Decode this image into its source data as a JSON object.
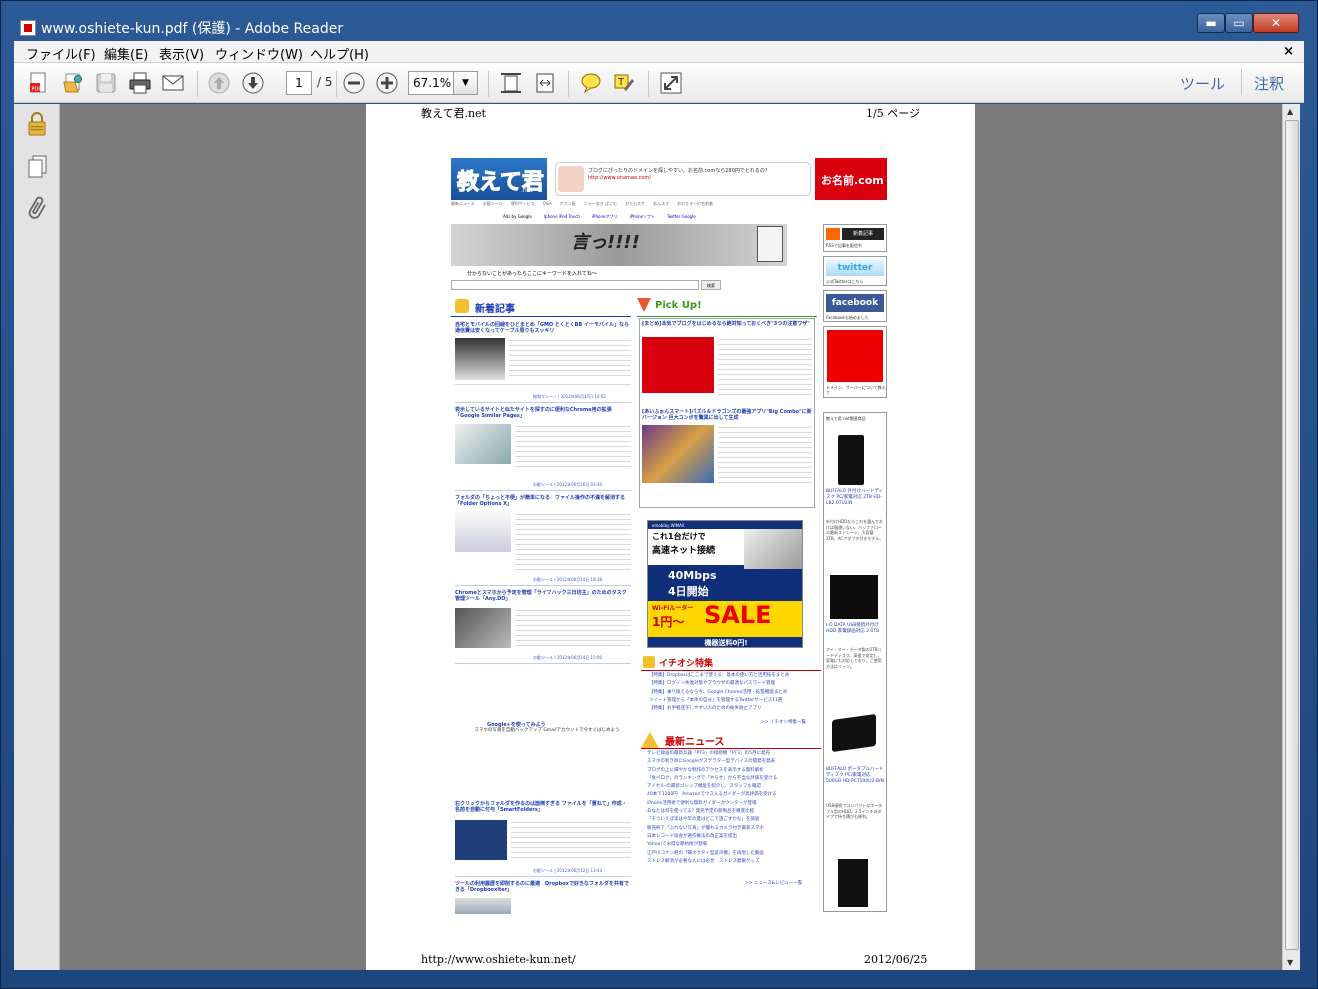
{
  "window": {
    "title": "www.oshiete-kun.pdf (保護) - Adobe Reader",
    "min": "▬",
    "max": "▭",
    "close": "✕"
  },
  "menus": [
    "ファイル(F)",
    "編集(E)",
    "表示(V)",
    "ウィンドウ(W)",
    "ヘルプ(H)"
  ],
  "menu_close": "×",
  "toolbar": {
    "page_current": "1",
    "page_total": "/ 5",
    "zoom": "67.1%",
    "tools": "ツール",
    "comment": "注釈"
  },
  "document": {
    "header_left": "教えて君.net",
    "header_right": "1/5 ページ",
    "footer_left": "http://www.oshiete-kun.net/",
    "footer_right": "2012/06/25",
    "logo": "教えて君",
    "logo_net": ".net",
    "ad_text": "ブログにぴったりのドメインを探しやすい。お名前.comなら280円でとれるの?",
    "ad_url": "http://www.onamae.com/",
    "ad_brand": "お名前.com",
    "nav": "最新ニュース　　お勧ツール　　便利サービス　　Q&A　　ボカン板　　ニャーおき ぱこむ　　おたもスケ　　あんスマ　　おわりマーの名前着",
    "adlinks": [
      "Ads by Google",
      "Iphone iPod Touch",
      "iPhoneアプリ",
      "iPhoneソフト",
      "Twitter Google"
    ],
    "search_prompt": "分からないことがあったらここにキーワードを入れてね～",
    "search_btn": "検索",
    "banner_text": "言っ!!!!",
    "new_articles_title": "新着記事",
    "pickup_title": "Pick Up!",
    "articles": [
      {
        "title": "自宅とモバイルの回線をひとまとめ「GMO とくとくBB イーモバイル」なら通信費は安くなってケーブル周りもスッキリ",
        "date": "総和マシーン | 2012年06月17日 14:02"
      },
      {
        "title": "表示しているサイトと似たサイトを探すのに便利なChrome用の拡張「Google Similar Pages」",
        "date": "お勧ツール | 2012年06月16日 03:40"
      },
      {
        "title": "フォルダの「ちょっと不便」が簡単になる　ファイル操作の不満を解消する「Folder Options X」",
        "date": "お勧ツール | 2012年06月14日 18:38"
      },
      {
        "title": "Chromeとスマホから予定を管理「ライフハック三日坊主」のためのタスク管理ツール「Any.DO」",
        "date": "お勧ツール | 2012年06月14日 15:00"
      },
      {
        "title": "右クリックからフォルダを作るのは面倒すぎる ファイルを「重ねて」作成・名前を自動に付与「SmartFolders」",
        "date": "お勧ツール | 2012年06月12日 13:43"
      },
      {
        "title": "ツールの利用履歴を即削するのに最適　Dropboxで好きなフォルダを共有できる「Dropbooxlter」",
        "date": ""
      }
    ],
    "google_plus": "Google+を使ってみよう",
    "google_plus_sub": "スマホの写真を自動バックアップ Gmailアカウントで今すぐはじめよう",
    "pick_items": [
      {
        "title": "[まとめ]本気でブログをはじめるなら絶対知っておくべき\"3つの注意ワザ\""
      },
      {
        "title": "[あいふぉんスマート]パズル＆ドラゴンズの最強アプリ\"Big Combo\"に新バージョン 巨大コンボを驚異に出して生成"
      }
    ],
    "wimax_ad": {
      "top": "emobiby WiMAX",
      "l1": "これ1台だけで",
      "l2": "高速ネット接続",
      "l3": "40Mbps",
      "l4": "4日開始",
      "l5": "Wi-Fiルーター",
      "l6": "1円〜",
      "l7": "SALE",
      "l8": "機器送料0円!"
    },
    "feature_title": "イチオシ特集",
    "features": [
      "【特集】Dropboxはここまで使える：基本の使い方と活用技をまとめ",
      "【特集】ログイン失敗対策やブラウザの最適なパスワード管理",
      "【特集】乗り換えるなら今、Google Chrome活用・拡張機能まとめ",
      "ツイート管理から「本体の自分」を管理するTwitterサービス11選",
      "【特集】お手軽迷子しやすい人のための紛失防止アプリ"
    ],
    "feature_more": ">> イチオシ特集一覧",
    "news_title": "最新ニュース",
    "news": [
      "テレビ録画の最新兵器「PT3」の接続機「PT3」の5月に発売",
      "スマホの利き目にGoogleがステラター型デバイスの開発を発表",
      "ブログの上に細やかな制作のアクセスを表示する無料解析",
      "「食べログ」のランキングで「やらせ」から不当な評価を受ける",
      "アイセル-の最新ゴシップ機能を紹介し、スタッフも確認",
      "40本で1200円　Amazonでウス入るガイダーが高評価を受ける",
      "iPhone活用術で便利な無料ガイダーカウンターが登場",
      "あなたは何を使ってる? 発売予定の新製品を徹底比較",
      "「そういえば実は今年の夏はどこで過ごすかな」を調査",
      "販売終了「ぶれない写真」が撮れるカメラ付き最新スマホ",
      "日本レコード協会が著作権法の改正案を提出",
      "Yahoo!でお得な節約術が登場",
      "江戸川コナン君の「蝶ネクタイ型変声機」を再現した動画",
      "ストレス解消が必要な人には必見　ストレス発散グッズ"
    ],
    "news_more": ">> ニュース&レビュー一覧",
    "right": {
      "rss": "新着記事",
      "rss_sub": "RSSで記事を配信中",
      "twitter": "twitter",
      "twitter_sub": "公式Twitterはこちら",
      "facebook": "facebook",
      "facebook_sub": "Facebookも始めました",
      "domain": "ドメイン、サーバーについて教えて",
      "shop": "教えて君.net関連商品"
    },
    "products": [
      {
        "name": "BUFFALO 外付けハードディスク PC/家電対応 2TB HD-LB2.0TU2/N",
        "desc": "外付けHDDならこれを選んでおけば間違いない。バッファローの最新ストレージ、大容量2TB、ACアダプタ付きモデル。"
      },
      {
        "name": "I-O DATA USB接続外付けHDD 家電録画対応 2.0TB",
        "desc": "アイ・オー・データ製の2TBハードディスク。高速で安定し、家電にも対応しており、ご使用方法はリッツ。"
      },
      {
        "name": "BUFFALO ポータブルハードディスク PC/家電対応 500GB HD-PCT500U2-B/N",
        "desc": "USB接続でコンパクトなポータブル型のHDD。2.5インチのタイプで持ち運びも便利。"
      }
    ]
  }
}
